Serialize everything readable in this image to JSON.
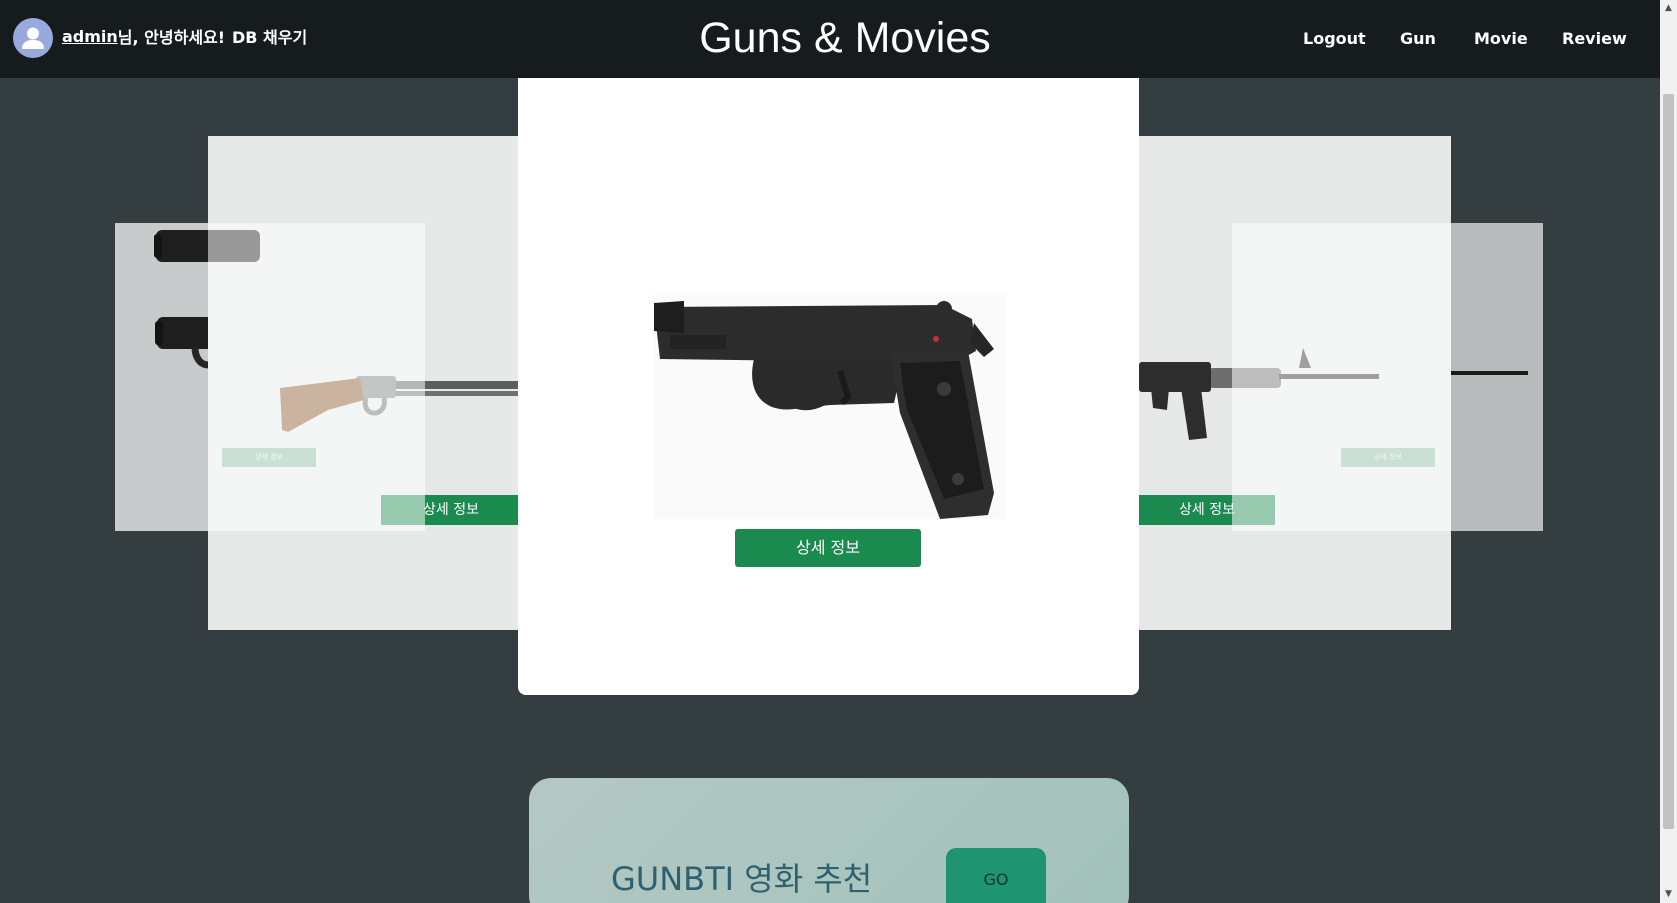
{
  "header": {
    "username": "admin",
    "greeting_suffix": "님, 안녕하세요!",
    "db_fill": "DB 채우기",
    "site_title": "Guns & Movies"
  },
  "nav": {
    "logout": "Logout",
    "gun": "Gun",
    "movie": "Movie",
    "review": "Review"
  },
  "carousel": {
    "detail_label": "상세 정보",
    "ghost_detail_label": "상세 정보",
    "items": [
      {
        "position": "far-left",
        "gun": "walther-ppk-pistol"
      },
      {
        "position": "near-left",
        "gun": "lever-action-rifle"
      },
      {
        "position": "center",
        "gun": "beretta-92fs-pistol"
      },
      {
        "position": "near-right",
        "gun": "m16-assault-rifle"
      },
      {
        "position": "far-right",
        "gun": "sniper-rifle"
      }
    ]
  },
  "gunbti": {
    "title": "GUNBTI 영화 추천",
    "go_label": "GO"
  },
  "colors": {
    "navbar": "#161b1d",
    "page_background": "#343d40",
    "detail_button": "#1b8a4f",
    "go_button": "#1e9470",
    "gunbti_title": "#2f6070"
  }
}
